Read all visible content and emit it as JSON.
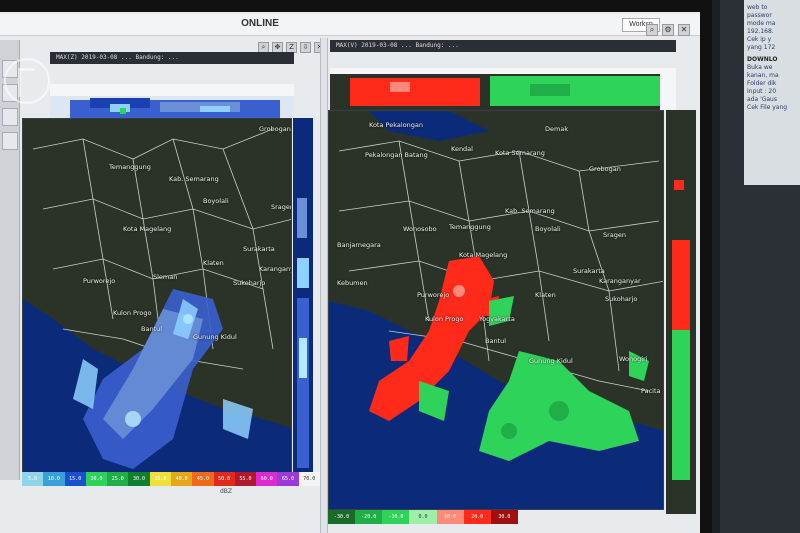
{
  "window": {
    "title": "ONLINE",
    "workspace_label": "Worksp"
  },
  "left_pane": {
    "header": "MAX(Z) 2019-03-08 ...  Bandung: ...",
    "labels": [
      {
        "id": "grobogan",
        "text": "Grobogan"
      },
      {
        "id": "temanggung",
        "text": "Temanggung"
      },
      {
        "id": "semarang",
        "text": "Kab. Semarang"
      },
      {
        "id": "boyolali",
        "text": "Boyolali"
      },
      {
        "id": "sragen",
        "text": "Sragen"
      },
      {
        "id": "magelang",
        "text": "Kota Magelang"
      },
      {
        "id": "surakarta",
        "text": "Surakarta"
      },
      {
        "id": "karanganyar",
        "text": "Karanganyar"
      },
      {
        "id": "purworejo",
        "text": "Purworejo"
      },
      {
        "id": "klaten",
        "text": "Klaten"
      },
      {
        "id": "sukoharjo",
        "text": "Sukoharjo"
      },
      {
        "id": "sleman",
        "text": "Sleman"
      },
      {
        "id": "kulonprogo",
        "text": "Kulon Progo"
      },
      {
        "id": "gunungkidul",
        "text": "Gunung Kidul"
      },
      {
        "id": "bantul",
        "text": "Bantul"
      }
    ],
    "legend": [
      "5.0",
      "10.0",
      "15.0",
      "20.0",
      "25.0",
      "30.0",
      "35.0",
      "40.0",
      "45.0",
      "50.0",
      "55.0",
      "60.0",
      "65.0",
      "70.0"
    ],
    "legend_unit": "dBZ"
  },
  "right_pane": {
    "header": "MAX(V) 2019-03-08 ...  Bandung: ...",
    "labels": [
      {
        "id": "pekalongan",
        "text": "Kota Pekalongan"
      },
      {
        "id": "demak",
        "text": "Demak"
      },
      {
        "id": "kendal",
        "text": "Kendal"
      },
      {
        "id": "kotasemarang",
        "text": "Kota Semarang"
      },
      {
        "id": "pekbatang",
        "text": "Pekalongan  Batang"
      },
      {
        "id": "grobogan",
        "text": "Grobogan"
      },
      {
        "id": "banjarnegara",
        "text": "Banjarnegara"
      },
      {
        "id": "temanggung",
        "text": "Temanggung"
      },
      {
        "id": "wonosobo",
        "text": "Wonosobo"
      },
      {
        "id": "semarang",
        "text": "Kab. Semarang"
      },
      {
        "id": "boyolali",
        "text": "Boyolali"
      },
      {
        "id": "sragen",
        "text": "Sragen"
      },
      {
        "id": "magelang",
        "text": "Kota Magelang"
      },
      {
        "id": "surakarta",
        "text": "Surakarta"
      },
      {
        "id": "kebumen",
        "text": "Kebumen"
      },
      {
        "id": "purworejo",
        "text": "Purworejo"
      },
      {
        "id": "klaten",
        "text": "Klaten"
      },
      {
        "id": "karanganyar",
        "text": "Karanganyar"
      },
      {
        "id": "sukoharjo",
        "text": "Sukoharjo"
      },
      {
        "id": "kulonprogo",
        "text": "Kulon Progo"
      },
      {
        "id": "yogyakarta",
        "text": "Yogyakarta"
      },
      {
        "id": "bantul",
        "text": "Bantul"
      },
      {
        "id": "gunungkidul",
        "text": "Gunung Kidul"
      },
      {
        "id": "wonogiri",
        "text": "Wonogiri"
      },
      {
        "id": "pacitan",
        "text": "Pacita"
      }
    ],
    "legend": [
      "-30.0",
      "-20.0",
      "-10.0",
      "0.0",
      "10.0",
      "20.0",
      "30.0"
    ]
  },
  "side_screen": {
    "lines": [
      "web to",
      "passwor",
      "mode ma",
      "192.168.",
      "Cek ip y",
      "yang 172"
    ],
    "heading": "DOWNLO",
    "lines2": [
      "Buka we",
      "kanan, ma",
      "Folder dik",
      "Input : 20",
      "ada 'Gaus",
      "Cek File yang"
    ]
  },
  "colors": {
    "sea": "#0c2a7a",
    "land": "#2b3328",
    "reflectivity": [
      "#6a8fd6",
      "#3a5fcf",
      "#8ed0ff",
      "#b6e8ff"
    ],
    "velocity_toward": "#ff2a1a",
    "velocity_away": "#2ed45a"
  }
}
